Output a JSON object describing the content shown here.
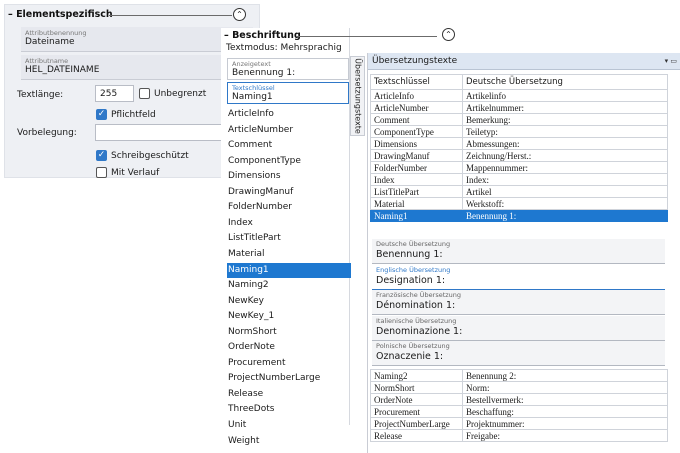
{
  "elementspezifisch": {
    "title": "Elementspezifisch",
    "attribute_label_caption": "Attributbenennung",
    "attribute_label_value": "Dateiname",
    "attribute_name_caption": "Attributname",
    "attribute_name_value": "HEL_DATEINAME",
    "text_length_label": "Textlänge:",
    "text_length_value": "255",
    "unlimited_label": "Unbegrenzt",
    "required_label": "Pflichtfeld",
    "default_label": "Vorbelegung:",
    "default_value": "",
    "write_protected_label": "Schreibgeschützt",
    "with_history_label": "Mit Verlauf",
    "collapse_glyph": "⌃"
  },
  "beschriftung": {
    "title": "Beschriftung",
    "text_mode": "Textmodus: Mehrsprachig",
    "display_text_caption": "Anzeigetext",
    "display_text_value": "Benennung 1:",
    "text_key_caption": "Textschlüssel",
    "text_key_value": "Naming1",
    "collapse_glyph": "⌃",
    "items": [
      "ArticleInfo",
      "ArticleNumber",
      "Comment",
      "ComponentType",
      "Dimensions",
      "DrawingManuf",
      "FolderNumber",
      "Index",
      "ListTitlePart",
      "Material",
      "Naming1",
      "Naming2",
      "NewKey",
      "NewKey_1",
      "NormShort",
      "OrderNote",
      "Procurement",
      "ProjectNumberLarge",
      "Release",
      "ThreeDots",
      "Unit",
      "Weight"
    ],
    "selected_item": "Naming1"
  },
  "vertical_tab": {
    "label": "Übersetzungstexte"
  },
  "uebersetzung": {
    "title": "Übersetzungstexte",
    "controls": "▾ ▭",
    "col_key": "Textschlüssel",
    "col_de": "Deutsche Übersetzung",
    "rows_top": [
      {
        "key": "ArticleInfo",
        "de": "Artikelinfo"
      },
      {
        "key": "ArticleNumber",
        "de": "Artikelnummer:"
      },
      {
        "key": "Comment",
        "de": "Bemerkung:"
      },
      {
        "key": "ComponentType",
        "de": "Teiletyp:"
      },
      {
        "key": "Dimensions",
        "de": "Abmessungen:"
      },
      {
        "key": "DrawingManuf",
        "de": "Zeichnung/Herst.:"
      },
      {
        "key": "FolderNumber",
        "de": "Mappennummer:"
      },
      {
        "key": "Index",
        "de": "Index:"
      },
      {
        "key": "ListTitlePart",
        "de": "Artikel"
      },
      {
        "key": "Material",
        "de": "Werkstoff:"
      },
      {
        "key": "Naming1",
        "de": "Benennung 1:"
      }
    ],
    "translations": [
      {
        "caption": "Deutsche Übersetzung",
        "value": "Benennung 1:"
      },
      {
        "caption": "Englische Übersetzung",
        "value": "Designation 1:"
      },
      {
        "caption": "Französische Übersetzung",
        "value": "Dénomination 1:"
      },
      {
        "caption": "Italienische Übersetzung",
        "value": "Denominazione 1:"
      },
      {
        "caption": "Polnische Übersetzung",
        "value": "Oznaczenie 1:"
      }
    ],
    "rows_bottom": [
      {
        "key": "Naming2",
        "de": "Benennung 2:"
      },
      {
        "key": "NormShort",
        "de": "Norm:"
      },
      {
        "key": "OrderNote",
        "de": "Bestellvermerk:"
      },
      {
        "key": "Procurement",
        "de": "Beschaffung:"
      },
      {
        "key": "ProjectNumberLarge",
        "de": "Projektnummer:"
      },
      {
        "key": "Release",
        "de": "Freigabe:"
      }
    ]
  }
}
